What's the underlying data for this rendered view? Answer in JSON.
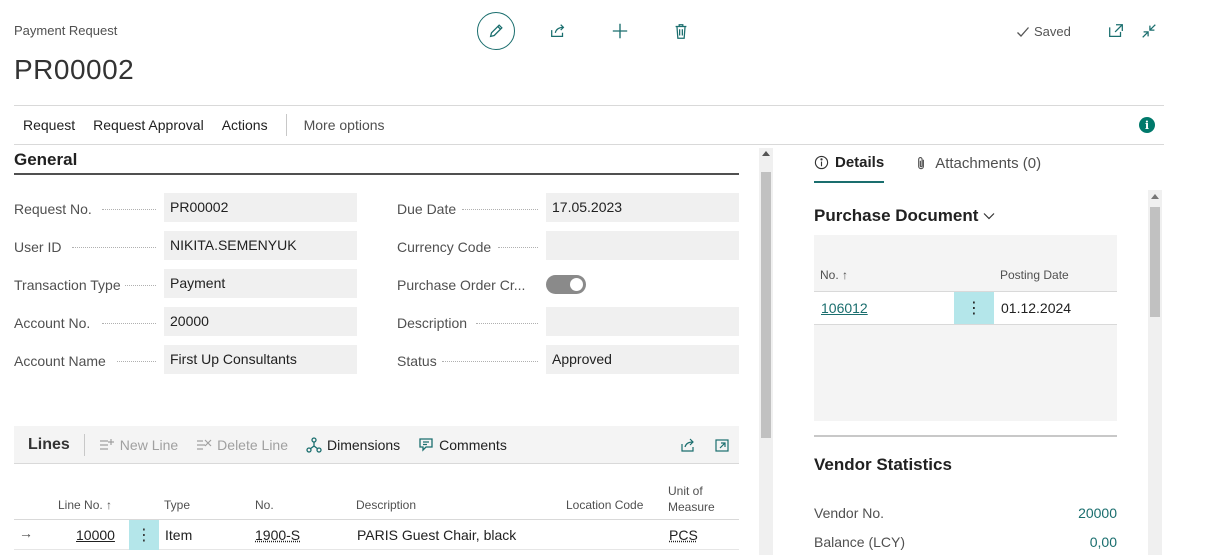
{
  "header": {
    "breadcrumb": "Payment Request",
    "record_title": "PR00002",
    "saved_label": "Saved",
    "icons": [
      "pencil-icon",
      "share-icon",
      "plus-icon",
      "trash-icon",
      "open-new-window-icon",
      "collapse-icon"
    ]
  },
  "actionbar": {
    "items": [
      "Request",
      "Request Approval",
      "Actions"
    ],
    "more": "More options"
  },
  "general": {
    "title": "General",
    "left_fields": [
      {
        "label": "Request No.",
        "value": "PR00002"
      },
      {
        "label": "User ID",
        "value": "NIKITA.SEMENYUK"
      },
      {
        "label": "Transaction Type",
        "value": "Payment"
      },
      {
        "label": "Account No.",
        "value": "20000"
      },
      {
        "label": "Account Name",
        "value": "First Up Consultants"
      }
    ],
    "right_fields": [
      {
        "label": "Due Date",
        "value": "17.05.2023"
      },
      {
        "label": "Currency Code",
        "value": ""
      },
      {
        "label": "Purchase Order Cr...",
        "value": "",
        "toggle_on": true
      },
      {
        "label": "Description",
        "value": ""
      },
      {
        "label": "Status",
        "value": "Approved"
      }
    ]
  },
  "lines": {
    "title": "Lines",
    "actions": {
      "new_line": "New Line",
      "delete_line": "Delete Line",
      "dimensions": "Dimensions",
      "comments": "Comments"
    },
    "columns": {
      "line_no": "Line No. ↑",
      "type": "Type",
      "no": "No.",
      "description": "Description",
      "location_code": "Location Code",
      "uom_1": "Unit of",
      "uom_2": "Measure"
    },
    "rows": [
      {
        "line_no": "10000",
        "type": "Item",
        "no": "1900-S",
        "description": "PARIS Guest Chair, black",
        "location_code": "",
        "uom": "PCS"
      }
    ]
  },
  "factbox": {
    "tabs": [
      "Details",
      "Attachments (0)"
    ],
    "purchase_document": {
      "title": "Purchase Document",
      "col_no": "No. ↑",
      "col_posting": "Posting Date",
      "rows": [
        {
          "no": "106012",
          "posting_date": "01.12.2024"
        }
      ]
    },
    "vendor_statistics": {
      "title": "Vendor Statistics",
      "rows": [
        {
          "label": "Vendor No.",
          "value": "20000"
        },
        {
          "label": "Balance (LCY)",
          "value": "0,00"
        }
      ]
    }
  },
  "colors": {
    "accent": "#1a6e6e",
    "row_highlight": "#b4e6ea",
    "info": "#00796b"
  }
}
